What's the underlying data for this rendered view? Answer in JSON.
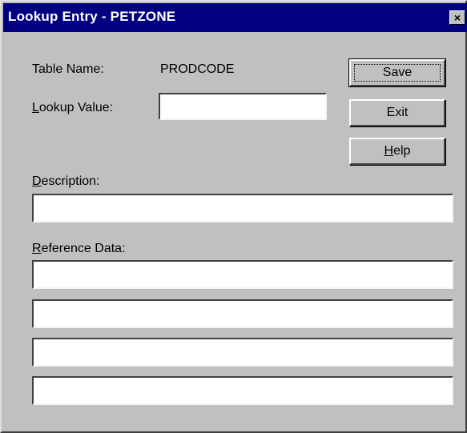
{
  "window": {
    "title": "Lookup Entry - PETZONE",
    "close_glyph": "×"
  },
  "form": {
    "table_name_label": "Table Name:",
    "table_name_value": "PRODCODE",
    "lookup_value_label_mn": "L",
    "lookup_value_label_rest": "ookup Value:",
    "lookup_value": "",
    "description_label_mn": "D",
    "description_label_rest": "escription:",
    "description_value": "",
    "reference_label_mn": "R",
    "reference_label_rest": "eference Data:",
    "reference_values": [
      "",
      "",
      "",
      ""
    ]
  },
  "buttons": {
    "save": "Save",
    "exit": "Exit",
    "help_mn": "H",
    "help_rest": "elp"
  },
  "colors": {
    "titlebar": "#000080",
    "face": "#c0c0c0"
  }
}
